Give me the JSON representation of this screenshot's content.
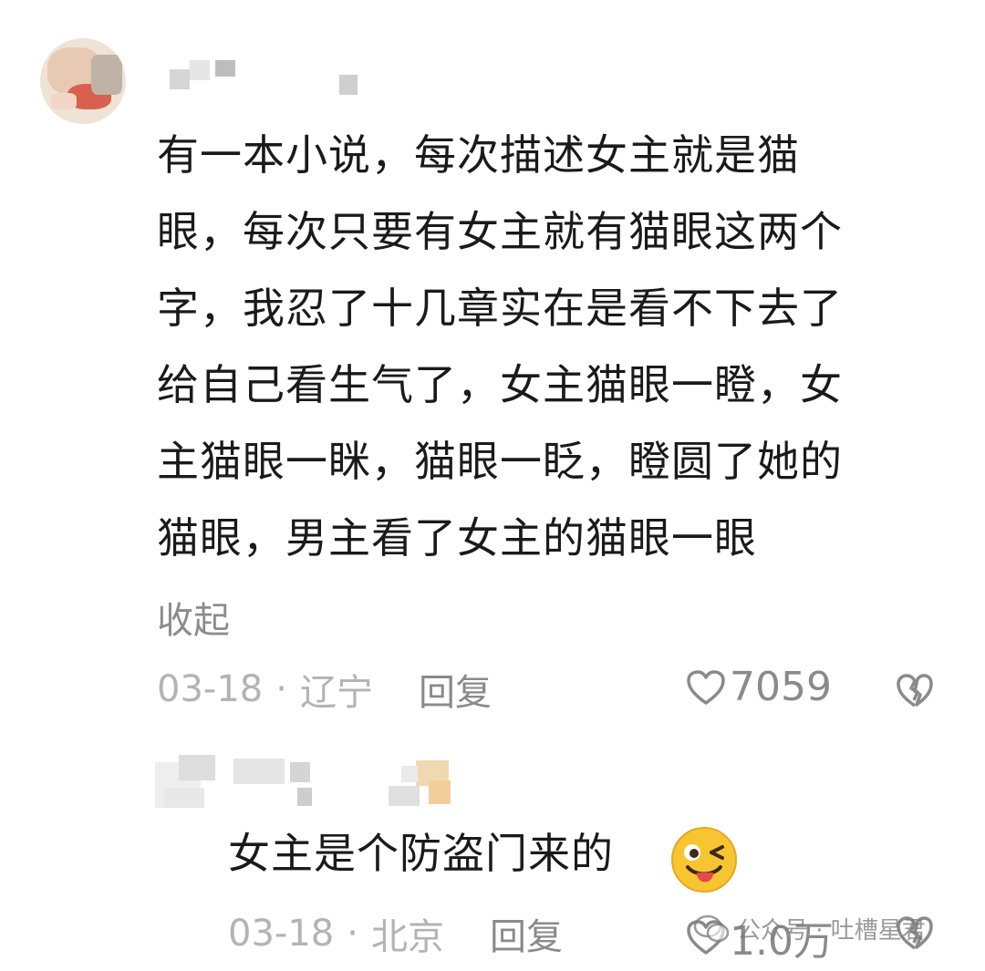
{
  "main_comment": {
    "text_lines": [
      "有一本小说，每次描述女主就是猫",
      "眼，每次只要有女主就有猫眼这两个",
      "字，我忍了十几章实在是看不下去了",
      "给自己看生气了，女主猫眼一瞪，女",
      "主猫眼一眯，猫眼一眨，瞪圆了她的",
      "猫眼，男主看了女主的猫眼一眼"
    ],
    "collapse_label": "收起",
    "date": "03-18",
    "location": "辽宁",
    "reply_label": "回复",
    "likes": "7059"
  },
  "reply_comment": {
    "text": "女主是个防盗门来的",
    "emoji": "winking-tongue-emoji",
    "date": "03-18",
    "location": "北京",
    "reply_label": "回复",
    "likes": "1.0万"
  },
  "separator": "·",
  "watermark": {
    "text": "公众号 · 吐槽星君"
  },
  "colors": {
    "text": "#1a1a1a",
    "meta": "#b3b3b3",
    "action": "#8a8a8a"
  }
}
